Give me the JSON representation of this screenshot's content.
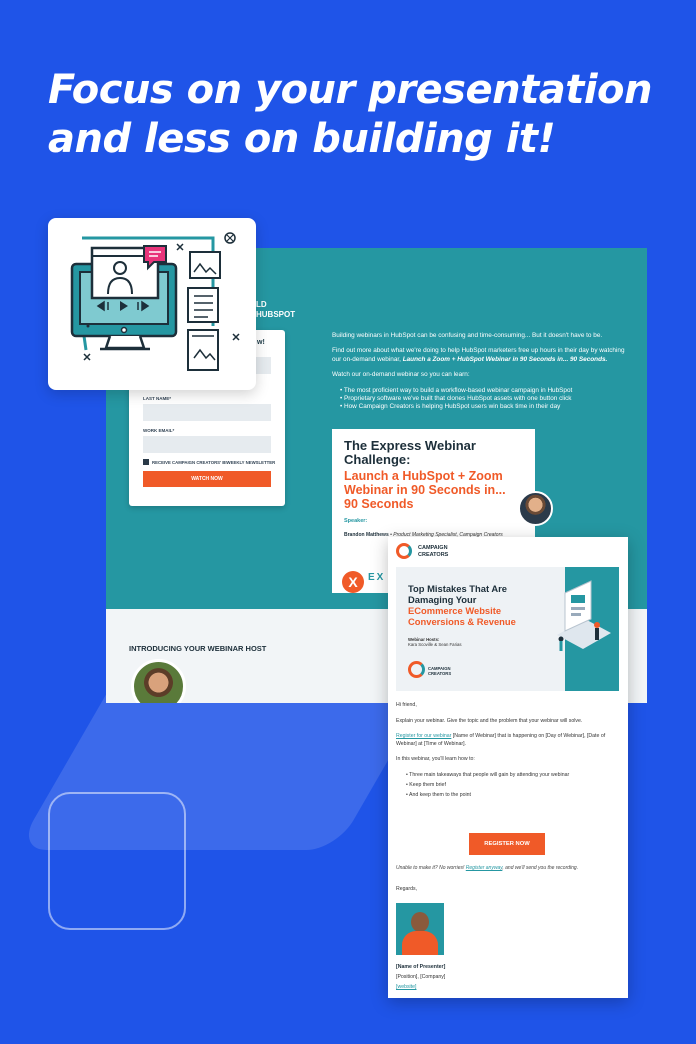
{
  "headline": {
    "line1": "Focus on your presentation",
    "line2": "and less on building it!"
  },
  "colors": {
    "background": "#1f54e8",
    "teal": "#2597a2",
    "orange": "#f05a28",
    "dark": "#1d2f3a"
  },
  "landing_page": {
    "strip_title_line1": "LD",
    "strip_title_line2": "HUBSPOT",
    "form": {
      "heading_fragment": "w!",
      "last_name_label": "LAST NAME*",
      "work_email_label": "WORK EMAIL*",
      "newsletter_label": "RECEIVE CAMPAIGN CREATORS' BIWEEKLY NEWSLETTER",
      "watch_button": "WATCH NOW"
    },
    "intro": {
      "p1": "Building webinars in HubSpot can be confusing and time-consuming... But it doesn't have to be.",
      "p2_start": "Find out more about what we're doing to help HubSpot marketers free up hours in their day by watching our on-demand webinar, ",
      "p2_emphasis": "Launch a Zoom + HubSpot Webinar in 90 Seconds in... 90 Seconds.",
      "p3": "Watch our on-demand webinar so you can learn:",
      "bullets": [
        "The most proficient way to build a workflow-based webinar campaign in HubSpot",
        "Proprietary software we've built that clones HubSpot assets with one button click",
        "How Campaign Creators is helping HubSpot users win back time in their day"
      ]
    },
    "promo": {
      "title": "The Express Webinar Challenge:",
      "subtitle": "Launch a HubSpot + Zoom Webinar in 90 Seconds in... 90 Seconds",
      "speaker_label": "Speaker:",
      "speaker_name": "Brandon Matthews",
      "speaker_role": " • Product Marketing Specialist, Campaign Creators",
      "logo_letter": "X",
      "logo_text": "EX"
    },
    "host_title": "INTRODUCING YOUR WEBINAR HOST"
  },
  "email": {
    "brand_name": "CAMPAIGN CREATORS",
    "banner": {
      "title": "Top Mistakes That Are Damaging Your",
      "title_highlight": "ECommerce Website Conversions & Revenue",
      "hosts_label": "Webinar Hosts:",
      "hosts_names": "Kara Scoville & Sean Farias",
      "brand_name": "CAMPAIGN CREATORS"
    },
    "greeting": "Hi friend,",
    "explain": "Explain your webinar. Give the topic and the problem that your webinar will solve.",
    "register_link": "Register for our webinar",
    "register_details": " [Name of Webinar] that is happening on [Day of Webinar], [Date of Webinar] at [Time of Webinar].",
    "learn_intro": "In this webinar, you'll learn how to:",
    "bullets": [
      "Three main takeaways that people will gain by attending your webinar",
      "Keep them brief",
      "And keep them to the point"
    ],
    "register_button": "REGISTER NOW",
    "unable_start": "Unable to make it? No worries! ",
    "unable_link": "Register anyway",
    "unable_end": ", and we'll send you the recording.",
    "regards": "Regards,",
    "presenter_name": "[Name of Presenter]",
    "presenter_position": "[Position], [Company]",
    "presenter_website": "[website]"
  },
  "icons": {
    "feature_icon": "webinar-monitor-icon"
  }
}
